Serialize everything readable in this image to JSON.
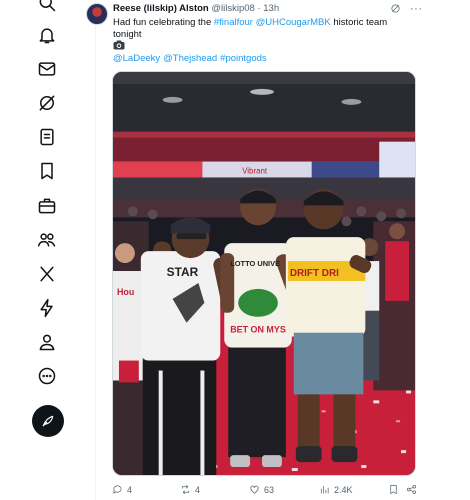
{
  "nav": {
    "items": [
      {
        "id": "search",
        "icon": "search-icon"
      },
      {
        "id": "notifications",
        "icon": "bell-icon"
      },
      {
        "id": "messages",
        "icon": "envelope-icon"
      },
      {
        "id": "grok",
        "icon": "grok-icon"
      },
      {
        "id": "lists",
        "icon": "list-icon"
      },
      {
        "id": "bookmarks",
        "icon": "bookmark-icon"
      },
      {
        "id": "jobs",
        "icon": "briefcase-icon"
      },
      {
        "id": "communities",
        "icon": "people-icon"
      },
      {
        "id": "premium",
        "icon": "x-logo-icon"
      },
      {
        "id": "verified-orgs",
        "icon": "lightning-icon"
      },
      {
        "id": "profile",
        "icon": "person-icon"
      },
      {
        "id": "more",
        "icon": "more-circle-icon"
      }
    ],
    "compose_icon": "feather-plus-icon"
  },
  "tweet": {
    "author_name": "Reese (lilskip) Alston",
    "author_handle": "@lilskip08",
    "separator": "·",
    "time": "13h",
    "text_prefix": "Had fun celebrating the ",
    "hashtag_1": "#finalfour",
    "text_space": " ",
    "mention_1": "@UHCougarMBK",
    "text_suffix": " historic team tonight",
    "media_emoji_icon": "camera-icon",
    "mention_2": "@LaDeeky",
    "mention_3": "@Thejshead",
    "hashtag_2": "#pointgods",
    "media": {
      "arena_banner": "Vibrant",
      "shirt_text_1": "STAR",
      "shirt_text_2": "LOTTO UNIVE",
      "shirt_text_3": "BET ON MYSE",
      "shirt_text_4": "DRIFT DRI",
      "sign_text": "Hou"
    },
    "actions": {
      "replies": "4",
      "reposts": "4",
      "likes": "63",
      "views": "2.4K"
    }
  },
  "colors": {
    "link": "#1d9bf0",
    "text": "#0f1419",
    "muted": "#536471"
  }
}
